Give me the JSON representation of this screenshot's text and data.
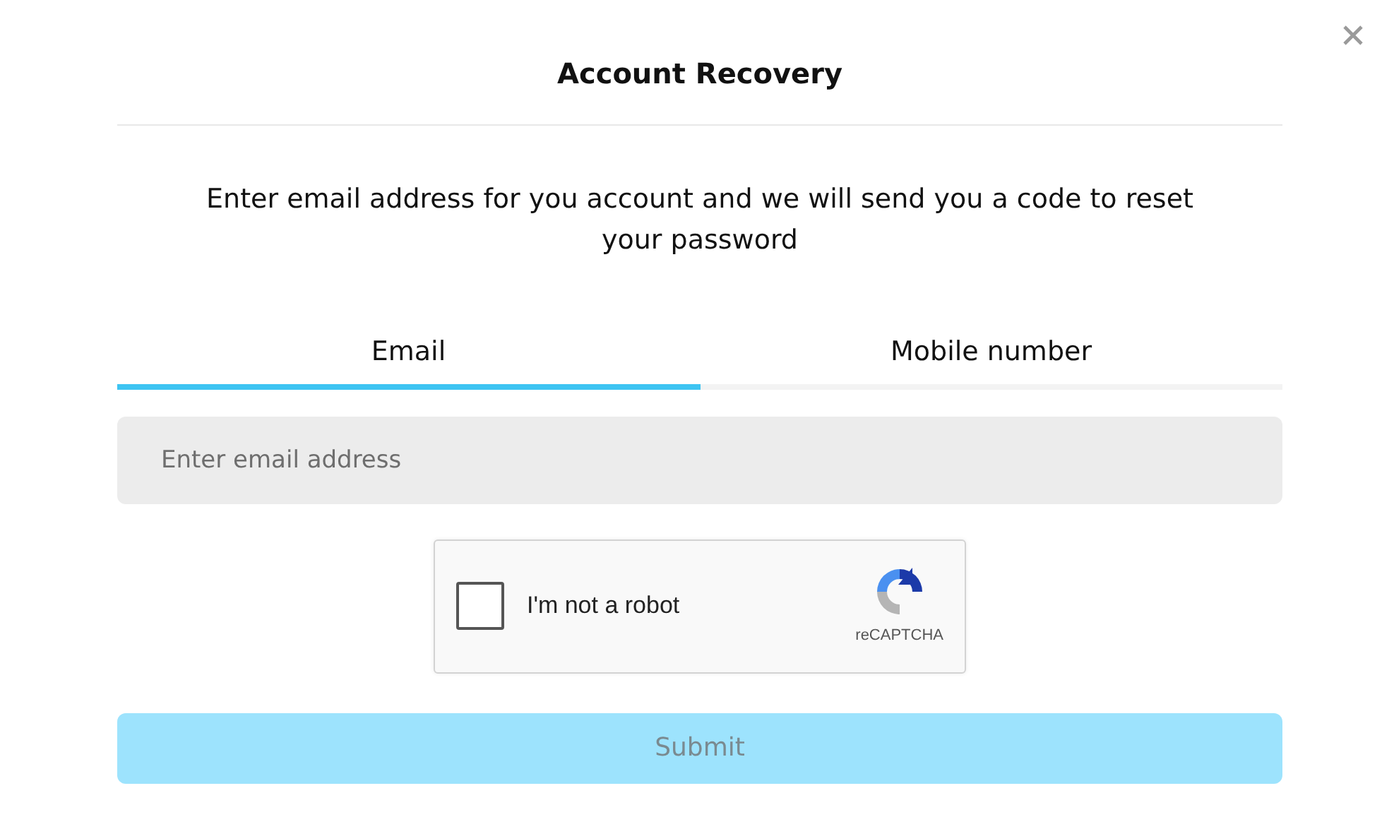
{
  "dialog": {
    "title": "Account Recovery",
    "description": "Enter email address for you account and we will send you a code to reset your password"
  },
  "tabs": [
    {
      "label": "Email",
      "selected": true
    },
    {
      "label": "Mobile number",
      "selected": false
    }
  ],
  "email_field": {
    "placeholder": "Enter email address"
  },
  "captcha": {
    "label": "I'm not a robot",
    "brand": "reCAPTCHA",
    "checked": false
  },
  "submit": {
    "label": "Submit",
    "disabled": true
  }
}
